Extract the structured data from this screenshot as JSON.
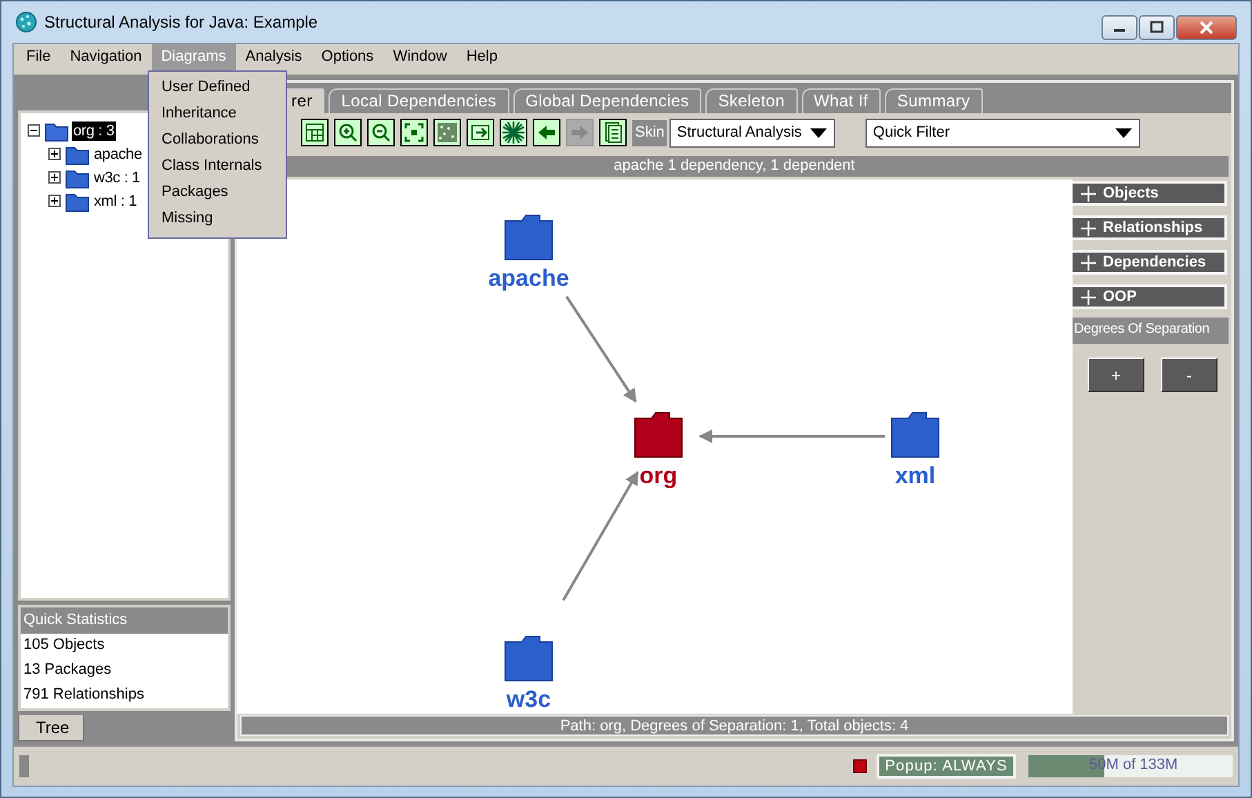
{
  "window": {
    "title": "Structural Analysis for Java: Example"
  },
  "menu_bar": [
    {
      "label": "File",
      "selected": false
    },
    {
      "label": "Navigation",
      "selected": false
    },
    {
      "label": "Diagrams",
      "selected": true
    },
    {
      "label": "Analysis",
      "selected": false
    },
    {
      "label": "Options",
      "selected": false
    },
    {
      "label": "Window",
      "selected": false
    },
    {
      "label": "Help",
      "selected": false
    }
  ],
  "open_menu": {
    "items": [
      "User Defined",
      "Inheritance",
      "Collaborations",
      "Class Internals",
      "Packages",
      "Missing"
    ]
  },
  "tree": {
    "label": "org : 3",
    "selected": true,
    "expanded": true,
    "children": [
      {
        "label": "apache",
        "selected": false,
        "expanded": false
      },
      {
        "label": "w3c : 1",
        "selected": false,
        "expanded": false
      },
      {
        "label": "xml : 1",
        "selected": false,
        "expanded": false
      }
    ]
  },
  "quick_statistics": {
    "title": "Quick Statistics",
    "lines": [
      "105 Objects",
      "13 Packages",
      "791 Relationships"
    ]
  },
  "left_tabs": [
    {
      "label": "Tree",
      "selected": true
    }
  ],
  "tabs": [
    {
      "label": "rer",
      "selected": true
    },
    {
      "label": "Local Dependencies",
      "selected": false
    },
    {
      "label": "Global Dependencies",
      "selected": false
    },
    {
      "label": "Skeleton",
      "selected": false
    },
    {
      "label": "What If",
      "selected": false
    },
    {
      "label": "Summary",
      "selected": false
    }
  ],
  "toolbar": {
    "buttons": [
      {
        "kind": "table",
        "disabled": false
      },
      {
        "kind": "zoom-in",
        "disabled": false
      },
      {
        "kind": "zoom-out",
        "disabled": false
      },
      {
        "kind": "fit",
        "disabled": false
      },
      {
        "kind": "noise",
        "disabled": false
      },
      {
        "kind": "refresh",
        "disabled": false
      },
      {
        "kind": "burst",
        "disabled": false
      },
      {
        "kind": "back",
        "disabled": false
      },
      {
        "kind": "forward",
        "disabled": true
      },
      {
        "kind": "pages",
        "disabled": false
      }
    ],
    "skin_label": "Skin",
    "skin": "Structural Analysis",
    "filter": "Quick Filter"
  },
  "info_bar": "apache 1 dependency, 1 dependent",
  "graph": {
    "nodes": [
      {
        "label": "apache",
        "selected": false
      },
      {
        "label": "org",
        "selected": true
      },
      {
        "label": "xml",
        "selected": false
      },
      {
        "label": "w3c",
        "selected": false
      }
    ]
  },
  "side_panel": {
    "sections": [
      "Objects",
      "Relationships",
      "Dependencies",
      "OOP"
    ],
    "separation_title": "Degrees Of Separation",
    "buttons": [
      "+",
      "-"
    ]
  },
  "path_bar": "Path: org,  Degrees of Separation: 1, Total objects: 4",
  "status_bar": {
    "popup": "Popup: ALWAYS",
    "memory": {
      "reading": "50M of 133M",
      "level": 0.37
    }
  }
}
